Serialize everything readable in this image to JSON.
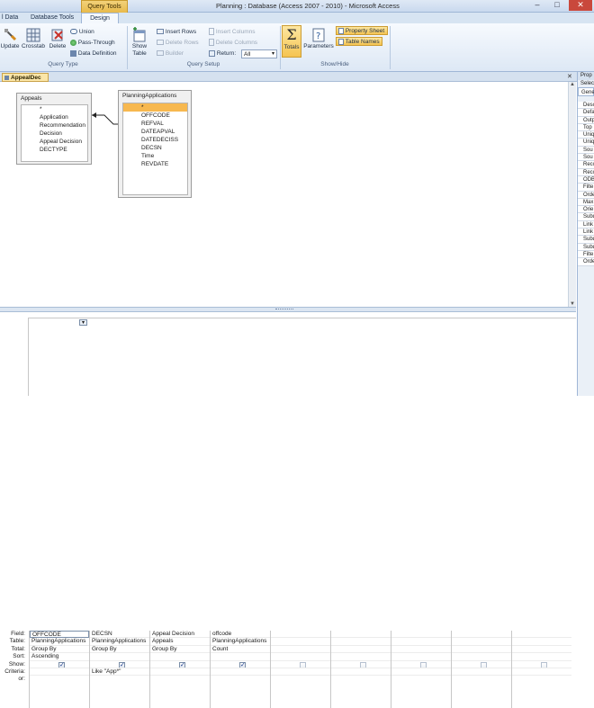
{
  "window": {
    "title": "Planning : Database (Access 2007 - 2010)  -  Microsoft Access",
    "context_tab": "Query Tools"
  },
  "tabs": [
    {
      "label": "l Data"
    },
    {
      "label": "Database Tools"
    },
    {
      "label": "Design"
    }
  ],
  "ribbon": {
    "query_type": {
      "group_label": "Query Type",
      "update": "Update",
      "crosstab": "Crosstab",
      "delete": "Delete",
      "union": "Union",
      "pass_through": "Pass-Through",
      "data_definition": "Data Definition"
    },
    "query_setup": {
      "group_label": "Query Setup",
      "show_table": "Show Table",
      "insert_rows": "Insert Rows",
      "delete_rows": "Delete Rows",
      "builder": "Builder",
      "insert_columns": "Insert Columns",
      "delete_columns": "Delete Columns",
      "return_label": "Return:",
      "return_value": "All"
    },
    "show_hide": {
      "group_label": "Show/Hide",
      "totals": "Totals",
      "parameters": "Parameters",
      "property_sheet": "Property Sheet",
      "table_names": "Table Names"
    }
  },
  "document_tab": "AppealDec",
  "tables": [
    {
      "name": "Appeals",
      "fields": [
        "*",
        "Application",
        "Recommendation",
        "Decision",
        "Appeal Decision",
        "DECTYPE"
      ]
    },
    {
      "name": "PlanningApplications",
      "fields": [
        "*",
        "OFFCODE",
        "REFVAL",
        "DATEAPVAL",
        "DATEDECISS",
        "DECSN",
        "Time",
        "REVDATE"
      ]
    }
  ],
  "property_sheet": {
    "title": "Prop",
    "selection": "Selec",
    "tab": "Gene",
    "rows": [
      "Desc",
      "Defa",
      "Outp",
      "Top",
      "Uniq",
      "Uniq",
      "Sou",
      "Sou",
      "Reco",
      "Reco",
      "ODB",
      "Filte",
      "Orde",
      "Max",
      "Orie",
      "Subd",
      "Link",
      "Link",
      "Subd",
      "Subd",
      "Filte",
      "Orde"
    ]
  },
  "grid": {
    "row_labels": [
      "Field:",
      "Table:",
      "Total:",
      "Sort:",
      "Show:",
      "Criteria:",
      "or:"
    ],
    "columns": [
      {
        "field": "OFFCODE",
        "table": "PlanningApplications",
        "total": "Group By",
        "sort": "Ascending",
        "show": true,
        "criteria": ""
      },
      {
        "field": "DECSN",
        "table": "PlanningApplications",
        "total": "Group By",
        "sort": "",
        "show": true,
        "criteria": "Like \"App*\""
      },
      {
        "field": "Appeal Decision",
        "table": "Appeals",
        "total": "Group By",
        "sort": "",
        "show": true,
        "criteria": ""
      },
      {
        "field": "offcode",
        "table": "PlanningApplications",
        "total": "Count",
        "sort": "",
        "show": true,
        "criteria": ""
      },
      {
        "field": "",
        "table": "",
        "total": "",
        "sort": "",
        "show": false,
        "criteria": ""
      },
      {
        "field": "",
        "table": "",
        "total": "",
        "sort": "",
        "show": false,
        "criteria": ""
      },
      {
        "field": "",
        "table": "",
        "total": "",
        "sort": "",
        "show": false,
        "criteria": ""
      },
      {
        "field": "",
        "table": "",
        "total": "",
        "sort": "",
        "show": false,
        "criteria": ""
      },
      {
        "field": "",
        "table": "",
        "total": "",
        "sort": "",
        "show": false,
        "criteria": ""
      }
    ]
  }
}
